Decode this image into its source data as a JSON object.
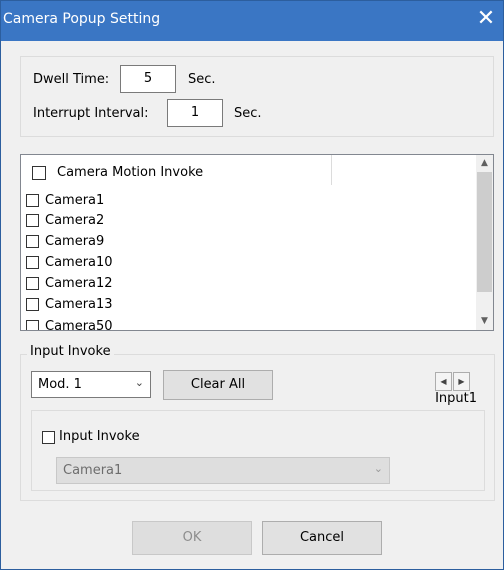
{
  "window": {
    "title": "Camera Popup Setting",
    "close_glyph": "✕"
  },
  "timing": {
    "dwell_label": "Dwell Time:",
    "dwell_value": "5",
    "dwell_unit": "Sec.",
    "interrupt_label": "Interrupt Interval:",
    "interrupt_value": "1",
    "interrupt_unit": "Sec."
  },
  "camera_list": {
    "header": "Camera Motion Invoke",
    "items": [
      {
        "label": "Camera1",
        "checked": false
      },
      {
        "label": "Camera2",
        "checked": false
      },
      {
        "label": "Camera9",
        "checked": false
      },
      {
        "label": "Camera10",
        "checked": false
      },
      {
        "label": "Camera12",
        "checked": false
      },
      {
        "label": "Camera13",
        "checked": false
      },
      {
        "label": "Camera50",
        "checked": false
      }
    ]
  },
  "input_invoke": {
    "group_label": "Input Invoke",
    "module_value": "Mod. 1",
    "clear_all_label": "Clear All",
    "current_input": "Input1",
    "checkbox_label": "Input Invoke",
    "camera_select_value": "Camera1"
  },
  "footer": {
    "ok_label": "OK",
    "cancel_label": "Cancel"
  },
  "colors": {
    "titlebar": "#3a76c4",
    "panel": "#f0f0f0",
    "border": "#dcdcdc"
  }
}
